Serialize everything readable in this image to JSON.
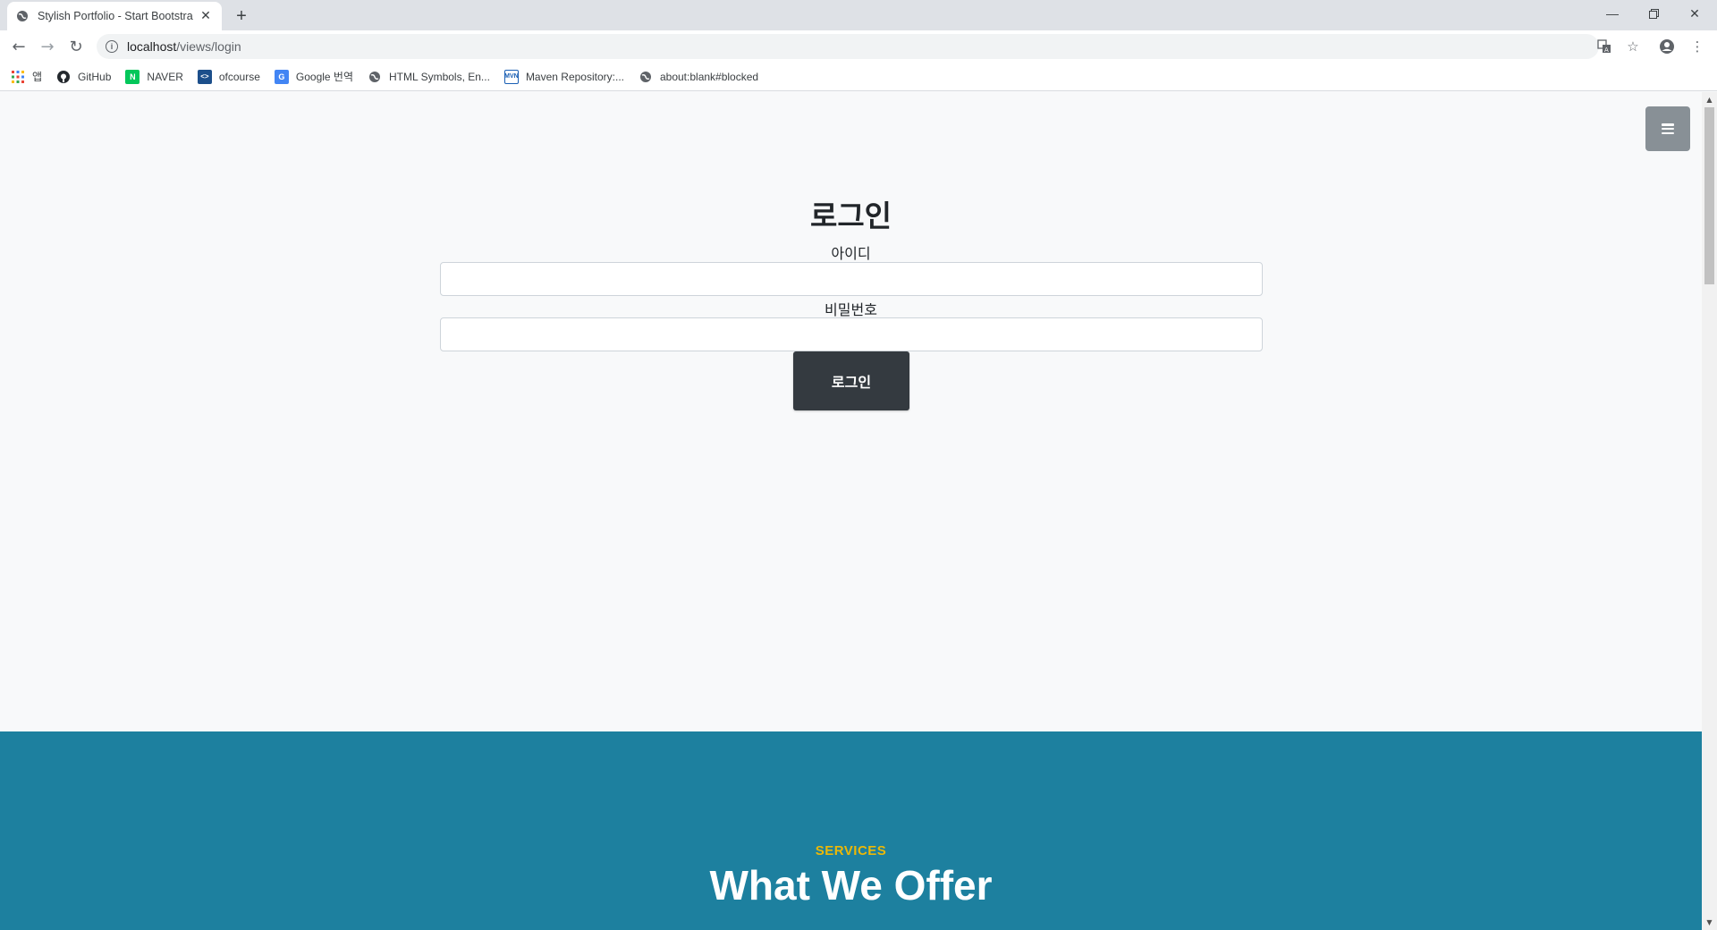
{
  "browser": {
    "tab_title": "Stylish Portfolio - Start Bootstra",
    "url_host": "localhost",
    "url_path": "/views/login",
    "bookmarks": [
      {
        "label": "앱",
        "icon": "apps-grid-icon"
      },
      {
        "label": "GitHub",
        "icon": "github-icon"
      },
      {
        "label": "NAVER",
        "icon": "naver-icon"
      },
      {
        "label": "ofcourse",
        "icon": "ofcourse-icon"
      },
      {
        "label": "Google 번역",
        "icon": "google-translate-icon"
      },
      {
        "label": "HTML Symbols, En...",
        "icon": "globe-icon"
      },
      {
        "label": "Maven Repository:...",
        "icon": "maven-icon"
      },
      {
        "label": "about:blank#blocked",
        "icon": "globe-icon"
      }
    ]
  },
  "login": {
    "title": "로그인",
    "id_label": "아이디",
    "password_label": "비밀번호",
    "submit_label": "로그인"
  },
  "services": {
    "subheading": "SERVICES",
    "heading": "What We Offer"
  },
  "colors": {
    "services_bg": "#1d809f",
    "accent": "#ecb807",
    "button_bg": "#343a40"
  }
}
